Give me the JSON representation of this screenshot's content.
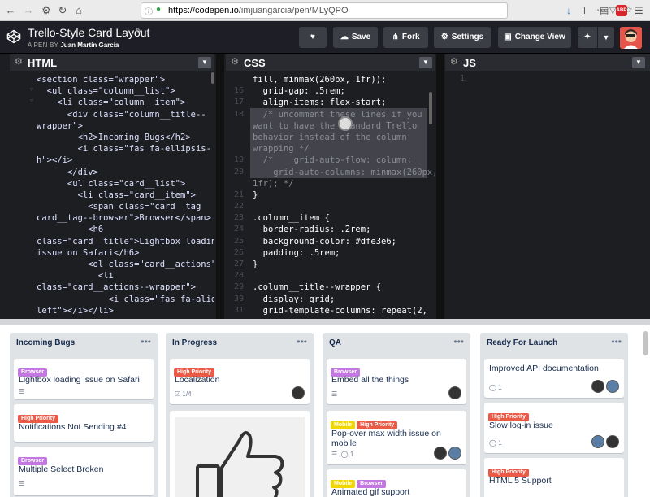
{
  "browser": {
    "url_domain": "https://codepen.io",
    "url_path": "/imjuangarcia/pen/MLyQPO",
    "adblock_label": "ABP"
  },
  "header": {
    "title": "Trello-Style Card Layout",
    "author_prefix": "A PEN BY",
    "author": "Juan Martín García",
    "buttons": {
      "save": "Save",
      "fork": "Fork",
      "settings": "Settings",
      "change_view": "Change View"
    }
  },
  "editors": {
    "html": {
      "title": "HTML",
      "lines": [
        "<section class=\"wrapper\">",
        "  <ul class=\"column__list\">",
        "    <li class=\"column__item\">",
        "      <div class=\"column__title--",
        "wrapper\">",
        "        <h2>Incoming Bugs</h2>",
        "        <i class=\"fas fa-ellipsis-",
        "h\"></i>",
        "      </div>",
        "      <ul class=\"card__list\">",
        "        <li class=\"card__item\">",
        "          <span class=\"card__tag",
        "card__tag--browser\">Browser</span>",
        "          <h6",
        "class=\"card__title\">Lightbox loading",
        "issue on Safari</h6>",
        "          <ol class=\"card__actions\">",
        "            <li",
        "class=\"card__actions--wrapper\">",
        "              <i class=\"fas fa-align-",
        "left\"></i></li>"
      ]
    },
    "css": {
      "title": "CSS",
      "rows": [
        {
          "n": "",
          "t": "fill, minmax(260px, 1fr));"
        },
        {
          "n": "16",
          "t": "  grid-gap: .5rem;"
        },
        {
          "n": "17",
          "t": "  align-items: flex-start;"
        },
        {
          "n": "18",
          "t": "  /* uncomment these lines if you"
        },
        {
          "n": "",
          "t": "want to have the standard Trello"
        },
        {
          "n": "",
          "t": "behavior instead of the column"
        },
        {
          "n": "",
          "t": "wrapping */"
        },
        {
          "n": "19",
          "t": "  /*    grid-auto-flow: column;"
        },
        {
          "n": "20",
          "t": "    grid-auto-columns: minmax(260px,"
        },
        {
          "n": "",
          "t": "1fr); */"
        },
        {
          "n": "21",
          "t": "}"
        },
        {
          "n": "22",
          "t": ""
        },
        {
          "n": "23",
          "t": ".column__item {"
        },
        {
          "n": "24",
          "t": "  border-radius: .2rem;"
        },
        {
          "n": "25",
          "t": "  background-color: #dfe3e6;"
        },
        {
          "n": "26",
          "t": "  padding: .5rem;"
        },
        {
          "n": "27",
          "t": "}"
        },
        {
          "n": "28",
          "t": ""
        },
        {
          "n": "29",
          "t": ".column__title--wrapper {"
        },
        {
          "n": "30",
          "t": "  display: grid;"
        },
        {
          "n": "31",
          "t": "  grid-template-columns: repeat(2,"
        }
      ]
    },
    "js": {
      "title": "JS",
      "first_line": "1"
    }
  },
  "columns": [
    {
      "title": "Incoming Bugs"
    },
    {
      "title": "In Progress"
    },
    {
      "title": "QA"
    },
    {
      "title": "Ready For Launch"
    }
  ],
  "cards": {
    "c1": {
      "tag1": "Browser",
      "title": "Lightbox loading issue on Safari"
    },
    "c2": {
      "tag1": "High Priority",
      "title": "Notifications Not Sending #4"
    },
    "c3": {
      "tag1": "Browser",
      "title": "Multiple Select Broken"
    },
    "p1": {
      "tag1": "High Priority",
      "title": "Localization",
      "checklist": "1/4"
    },
    "q1": {
      "tag1": "Browser",
      "title": "Embed all the things"
    },
    "q2": {
      "tag1": "Mobile",
      "tag2": "High Priority",
      "title": "Pop-over max width issue on mobile",
      "comments": "1"
    },
    "q3": {
      "tag1": "Mobile",
      "tag2": "Browser",
      "title": "Animated gif support"
    },
    "r1": {
      "title": "Improved API documentation",
      "comments": "1"
    },
    "r2": {
      "tag1": "High Priority",
      "title": "Slow log-in issue",
      "comments": "1"
    },
    "r3": {
      "tag1": "High Priority",
      "title": "HTML 5 Support"
    }
  }
}
